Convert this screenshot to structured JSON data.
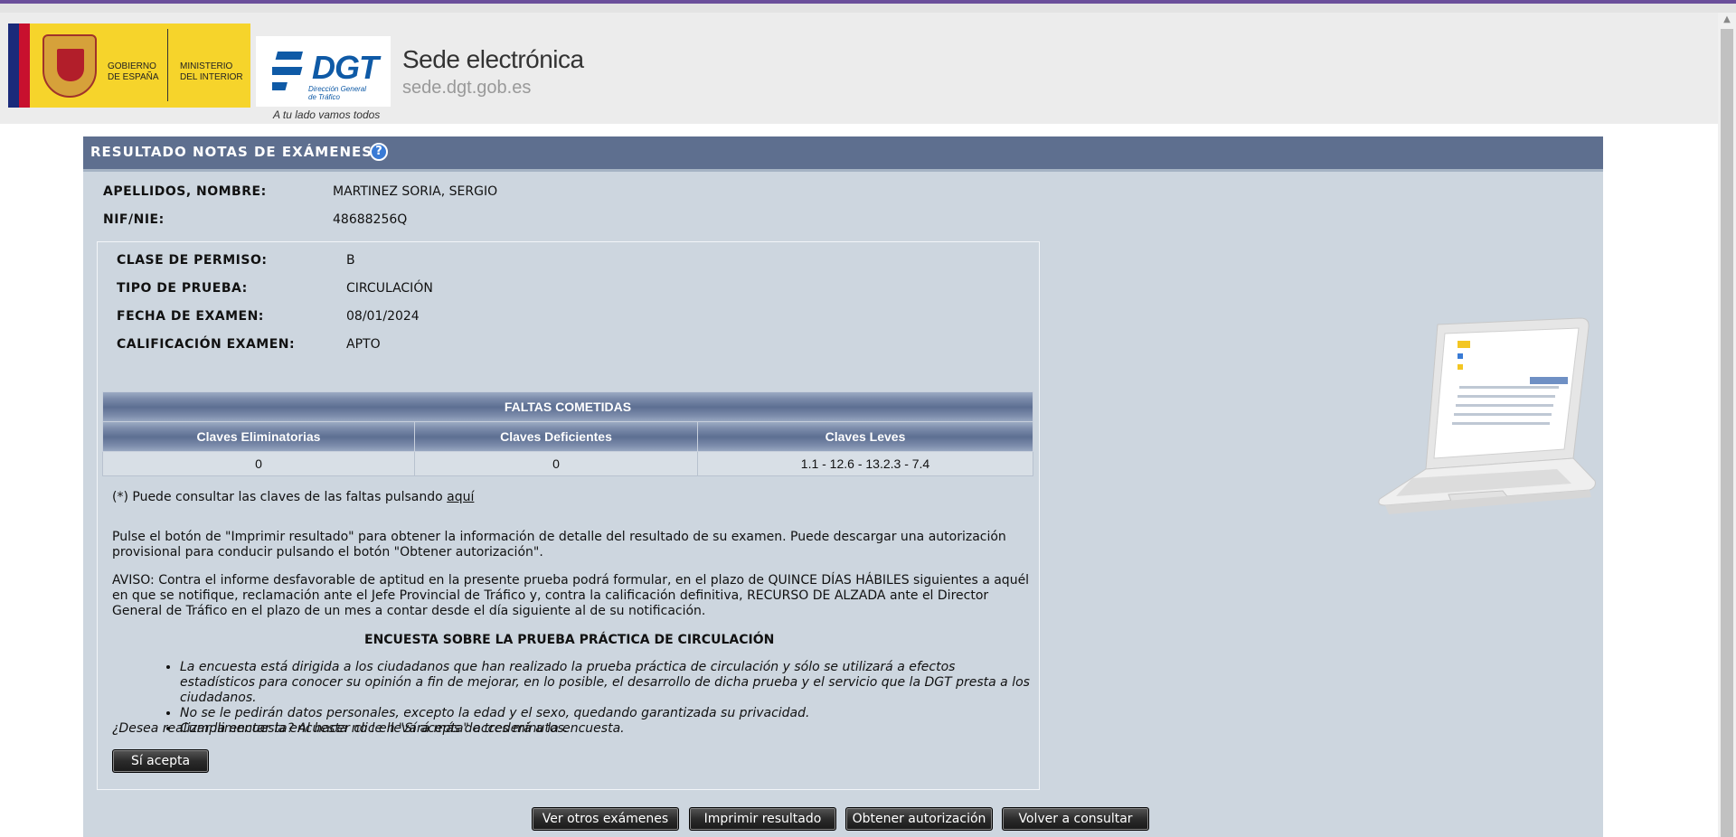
{
  "header": {
    "gov_logo_text_1": "GOBIERNO\nDE ESPAÑA",
    "gov_logo_text_2": "MINISTERIO\nDEL INTERIOR",
    "dgt_logo_mark": "DGT",
    "dgt_logo_sub": "Dirección General\nde Tráfico",
    "tagline": "A tu lado vamos todos",
    "site_title": "Sede electrónica",
    "site_url": "sede.dgt.gob.es"
  },
  "panel": {
    "title": "RESULTADO NOTAS DE EXÁMENES",
    "help_icon": "?"
  },
  "person": {
    "name_label": "APELLIDOS, NOMBRE:",
    "name_value": "MARTINEZ SORIA, SERGIO",
    "id_label": "NIF/NIE:",
    "id_value": "48688256Q"
  },
  "exam": {
    "permit_label": "CLASE DE PERMISO:",
    "permit_value": "B",
    "test_type_label": "TIPO DE PRUEBA:",
    "test_type_value": "CIRCULACIÓN",
    "date_label": "FECHA DE EXAMEN:",
    "date_value": "08/01/2024",
    "grade_label": "CALIFICACIÓN EXAMEN:",
    "grade_value": "APTO"
  },
  "faltas": {
    "title": "FALTAS COMETIDAS",
    "columns": [
      "Claves Eliminatorias",
      "Claves Deficientes",
      "Claves Leves"
    ],
    "row": [
      "0",
      "0",
      "1.1 - 12.6 - 13.2.3 - 7.4"
    ]
  },
  "note": {
    "prefix": "(*) Puede consultar las claves de las faltas pulsando ",
    "link": "aquí"
  },
  "info_text_1": "Pulse el botón de \"Imprimir resultado\" para obtener la información de detalle del resultado de su examen. Puede descargar una autorización provisional para conducir pulsando el botón \"Obtener autorización\".",
  "info_text_2": "AVISO: Contra el informe desfavorable de aptitud en la presente prueba podrá formular, en el plazo de QUINCE DÍAS HÁBILES siguientes a aquél en que se notifique, reclamación ante el Jefe Provincial de Tráfico y, contra la calificación definitiva, RECURSO DE ALZADA ante el Director General de Tráfico en el plazo de un mes a contar desde el día siguiente al de su notificación.",
  "survey": {
    "title": "ENCUESTA SOBRE LA PRUEBA PRÁCTICA DE CIRCULACIÓN",
    "items": [
      "La encuesta está dirigida a los ciudadanos que han realizado la prueba práctica de circulación y sólo se utilizará a efectos estadísticos para conocer su opinión a fin de mejorar, en lo posible, el desarrollo de dicha prueba y el servicio que la DGT presta a los ciudadanos.",
      "No se le pedirán datos personales, excepto la edad y el sexo, quedando garantizada su privacidad.",
      "Cumplimentar la encuesta no le llevará más de tres minutos."
    ],
    "question": "¿Desea realizar la encuesta? Al hacer clic en \"Sí acepta\" accederá a la encuesta.",
    "accept_button": "Sí acepta"
  },
  "actions": {
    "other_exams": "Ver otros exámenes",
    "print_result": "Imprimir resultado",
    "get_authorization": "Obtener autorización",
    "back": "Volver a consultar"
  },
  "colors": {
    "panel_bg": "#cdd6df",
    "panel_header": "#5e6f8f",
    "top_accent": "#6b4f9b",
    "button_dark": "#2b2b2b"
  }
}
